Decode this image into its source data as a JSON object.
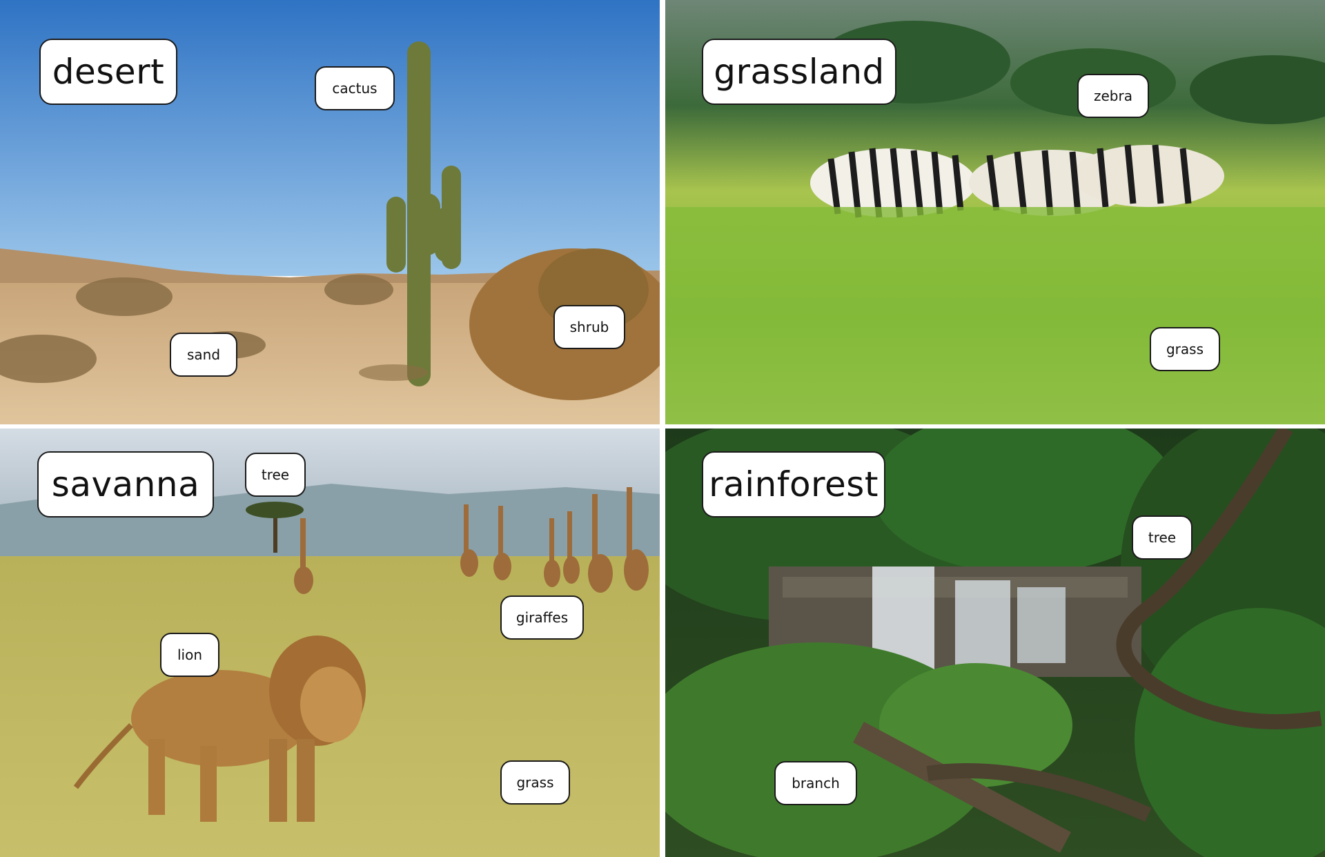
{
  "panels": {
    "desert": {
      "title": "desert",
      "labels": {
        "cactus": "cactus",
        "shrub": "shrub",
        "sand": "sand"
      }
    },
    "grassland": {
      "title": "grassland",
      "labels": {
        "zebra": "zebra",
        "grass": "grass"
      }
    },
    "savanna": {
      "title": "savanna",
      "labels": {
        "tree": "tree",
        "giraffes": "giraffes",
        "lion": "lion",
        "grass": "grass"
      }
    },
    "rainforest": {
      "title": "rainforest",
      "labels": {
        "tree": "tree",
        "branch": "branch"
      }
    }
  },
  "colors": {
    "desert_sky": "#3f86cf",
    "desert_sand": "#d8b88a",
    "grassland_green": "#8cc43c",
    "savanna_grass": "#c9b75a",
    "savanna_sky": "#c7d2dc",
    "rainforest_green": "#2f5a26",
    "label_border": "#1a1a1a"
  }
}
